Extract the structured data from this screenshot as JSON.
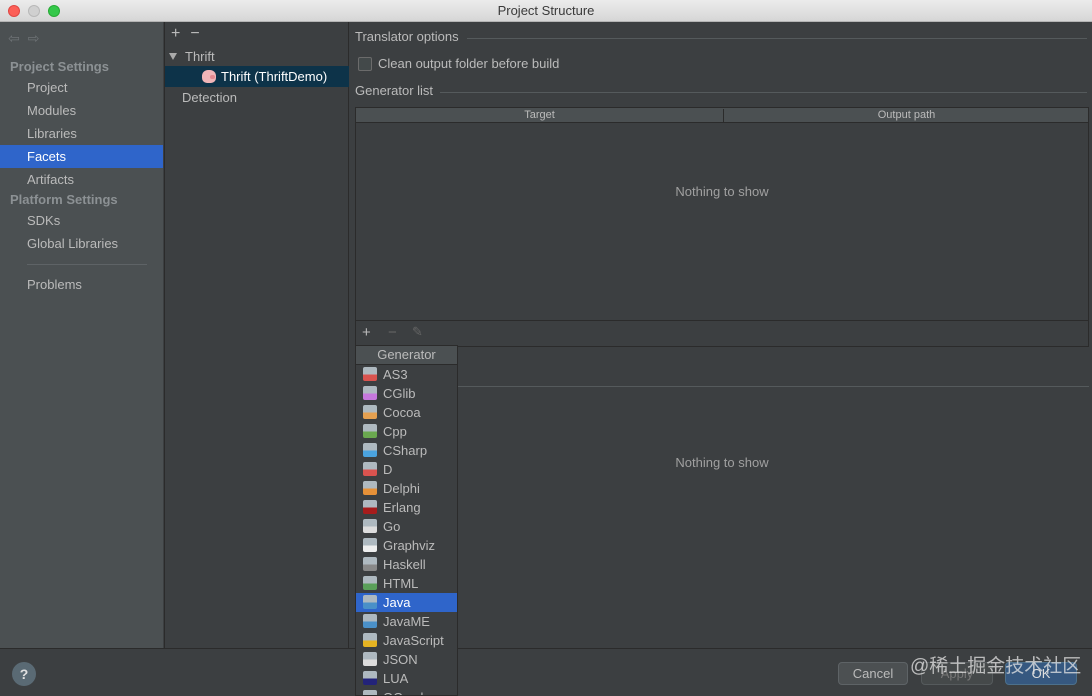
{
  "window": {
    "title": "Project Structure"
  },
  "sidebar": {
    "nav_back": "⇦",
    "nav_forward": "⇨",
    "sections": [
      {
        "header": "Project Settings",
        "items": [
          "Project",
          "Modules",
          "Libraries",
          "Facets",
          "Artifacts"
        ]
      },
      {
        "header": "Platform Settings",
        "items": [
          "SDKs",
          "Global Libraries"
        ]
      }
    ],
    "selected": "Facets",
    "problems": "Problems"
  },
  "facets_tree": {
    "add": "+",
    "remove": "−",
    "group": "Thrift",
    "facet": "Thrift (ThriftDemo)",
    "detection": "Detection"
  },
  "options": {
    "translator_title": "Translator options",
    "clean_label": "Clean output folder before build",
    "clean_checked": false,
    "generator_list_title": "Generator list",
    "columns": [
      "Target",
      "Output path"
    ],
    "empty_text": "Nothing to show",
    "empty_text_2": "Nothing to show",
    "add": "+",
    "remove": "−",
    "edit": "✎"
  },
  "generator_popup": {
    "header": "Generator",
    "selected": "Java",
    "items": [
      {
        "label": "AS3",
        "icon": "as3-icon",
        "color": "#d9534f"
      },
      {
        "label": "CGlib",
        "icon": "cglib-icon",
        "color": "#c678dd"
      },
      {
        "label": "Cocoa",
        "icon": "cocoa-icon",
        "color": "#e5a050"
      },
      {
        "label": "Cpp",
        "icon": "cpp-icon",
        "color": "#6aa84f"
      },
      {
        "label": "CSharp",
        "icon": "csharp-icon",
        "color": "#4aa3df"
      },
      {
        "label": "D",
        "icon": "d-icon",
        "color": "#d9534f"
      },
      {
        "label": "Delphi",
        "icon": "delphi-icon",
        "color": "#e69138"
      },
      {
        "label": "Erlang",
        "icon": "erlang-icon",
        "color": "#a61c1c"
      },
      {
        "label": "Go",
        "icon": "go-icon",
        "color": "#dddddd"
      },
      {
        "label": "Graphviz",
        "icon": "graphviz-icon",
        "color": "#eeeeee"
      },
      {
        "label": "Haskell",
        "icon": "haskell-icon",
        "color": "#888888"
      },
      {
        "label": "HTML",
        "icon": "html-icon",
        "color": "#5aa05a"
      },
      {
        "label": "Java",
        "icon": "java-icon",
        "color": "#4a90c8"
      },
      {
        "label": "JavaME",
        "icon": "javame-icon",
        "color": "#4a90c8"
      },
      {
        "label": "JavaScript",
        "icon": "javascript-icon",
        "color": "#e6b422"
      },
      {
        "label": "JSON",
        "icon": "json-icon",
        "color": "#dddddd"
      },
      {
        "label": "LUA",
        "icon": "lua-icon",
        "color": "#23237a"
      },
      {
        "label": "OCaml",
        "icon": "ocaml-icon",
        "color": "#e06c2c"
      }
    ]
  },
  "footer": {
    "help": "?",
    "cancel": "Cancel",
    "apply": "Apply",
    "ok": "OK",
    "watermark": "@稀土掘金技术社区"
  }
}
